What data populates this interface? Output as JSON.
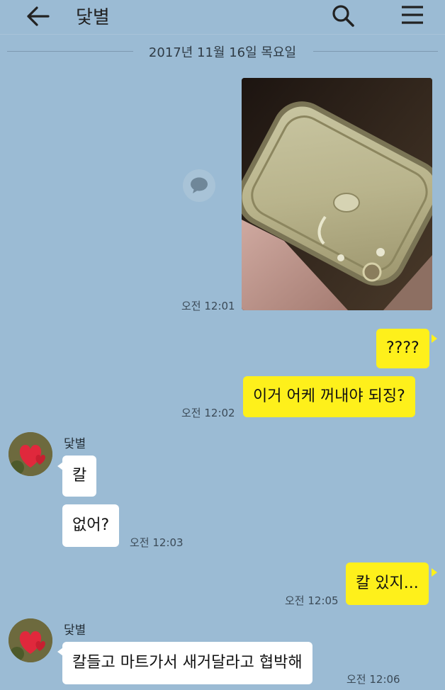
{
  "header": {
    "title": "닻별",
    "back_icon": "arrow-left-icon",
    "search_icon": "search-icon",
    "menu_icon": "hamburger-menu-icon"
  },
  "date_separator": "2017년 11월 16일 목요일",
  "colors": {
    "background": "#9bbbd4",
    "my_bubble": "#fef01b",
    "other_bubble": "#ffffff"
  },
  "messages": {
    "photo_time": "오전 12:01",
    "m1": "????",
    "m2": "이거 어케 꺼내야 되징?",
    "m2_time": "오전 12:02",
    "sender1": "닻별",
    "m3": "칼",
    "m4": "없어?",
    "m4_time": "오전 12:03",
    "m5": "칼 있지...",
    "m5_time": "오전 12:05",
    "sender2": "닻별",
    "m6": "칼들고 마트가서 새거달라고 협박해",
    "m6_time": "오전 12:06"
  }
}
